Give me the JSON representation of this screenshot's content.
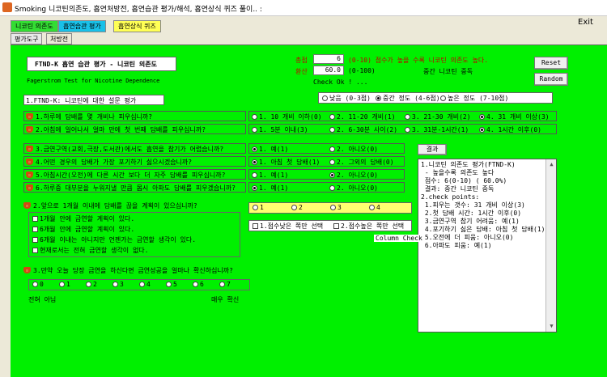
{
  "window": {
    "title": "Smoking 니코틴의존도, 흡연처방전, 흡연습관 평가/해석, 흡연상식 퀴즈 풀이.. :"
  },
  "top_tabs": [
    {
      "label": "니코틴 의존도",
      "color": "#33dd33"
    },
    {
      "label": "흡연습관 평가",
      "color": "#19c0e8"
    },
    {
      "label": "흡연상식 퀴즈",
      "color": "#ffff55"
    }
  ],
  "exit_label": "Exit",
  "sub_tabs": [
    "평가도구",
    "처방전"
  ],
  "header": {
    "title": "FTND-K  흡연 습관 평가 - 니코틴 의존도",
    "subtitle": "Fagerstrom Test for Nicotine Dependence",
    "total_label": "총점",
    "total_value": "6",
    "total_note": "(0-10) 점수가 높을 수록 니코틴 의존도 높다.",
    "conv_label": "환산",
    "conv_value": "60.0",
    "conv_note": "(0-100)",
    "level_text": "중간 니코틴 중독",
    "check_ok": "Check Ok ! ...",
    "reset": "Reset",
    "random": "Random"
  },
  "section1_title": "1.FTND-K: 니코틴에 대한 설문 평가",
  "levels": [
    "낮음 (0-3점)",
    "중간 정도 (4-6점)",
    "높은 정도 (7-10점)"
  ],
  "questions_4": [
    {
      "q": "1.하루에 담배를 몇 개비나 피우십니까?",
      "opts": [
        "1. 10 개비 이하(0)",
        "2. 11-20 개비(1)",
        "3. 21-30 개비(2)",
        "4. 31 개비 이상(3)"
      ]
    },
    {
      "q": "2.아침에 일어나서 얼마 만에 첫 번째 담배를 피우십니까?",
      "opts": [
        "1. 5분 이내(3)",
        "2. 6-30분 사이(2)",
        "3. 31분-1시간(1)",
        "4. 1시간 이후(0)"
      ]
    }
  ],
  "questions_2": [
    {
      "q": "3.금연구역(교회,극장,도서관)에서도 흡연을 참기가 어렵습니까?",
      "opts": [
        "1. 예(1)",
        "2. 아니오(0)"
      ]
    },
    {
      "q": "4.어떤 경우의 담배가 가장 포기하기 싫으시겠습니까?",
      "opts": [
        "1. 아침 첫 담배(1)",
        "2. 그외의 담배(0)"
      ]
    },
    {
      "q": "5.아침시간(오전)에 다른 시간 보다 더 자주 담배를 피우십니까?",
      "opts": [
        "1. 예(1)",
        "2. 아니오(0)"
      ]
    },
    {
      "q": "6.하루중 대부분을 누워지낼 만큼 몹시 아파도 담배를 피우겠습니까?",
      "opts": [
        "1. 예(1)",
        "2. 아니오(0)"
      ]
    }
  ],
  "result_button": "결과",
  "result_text": "1.니코틴 의존도 평가(FTND-K)\n - 높을수록 의존도 높다\n 점수: 6(0-10) ( 60.0%)\n 결과: 중간 니코틴 중독\n2.check points:\n 1.피우는 갯수: 31 개비 이상(3)\n 2.첫 담배 시간: 1시간 이후(0)\n 3.금연구역 참기 어려움: 예(1)\n 4.포기하기 싫은 담배: 아침 첫 담배(1)\n 5.오전에 더 피움: 아니오(0)\n 6.아파도 피움: 예(1)",
  "section2": {
    "title": "2.앞으로 1개월 이내에 담배를 끊을 계획이 있으십니까?",
    "items": [
      "1개월 안에 금연할 계획이 있다.",
      "6개월 안에 금연할 계획이 있다.",
      "6개월 이내는 아니지만 언젠가는 금연할 생각이 있다.",
      "현재로서는 전혀 금연할 생각이 없다."
    ],
    "nums": [
      "1",
      "2",
      "3",
      "4"
    ],
    "min_label": "1.점수낮은 쪽만 선택",
    "max_label": "2.점수높은 쪽만 선택",
    "column_check": "Column Check"
  },
  "section3": {
    "title": "3.만약 오늘 당장 금연을 하신다면 금연성공을 얼마나 확신하십니까?",
    "scale": [
      "0",
      "1",
      "2",
      "3",
      "4",
      "5",
      "6",
      "7"
    ],
    "low": "전혀 아님",
    "high": "매우 확신"
  },
  "colors": {
    "background": "#00f000",
    "accent_red": "#c00000"
  }
}
